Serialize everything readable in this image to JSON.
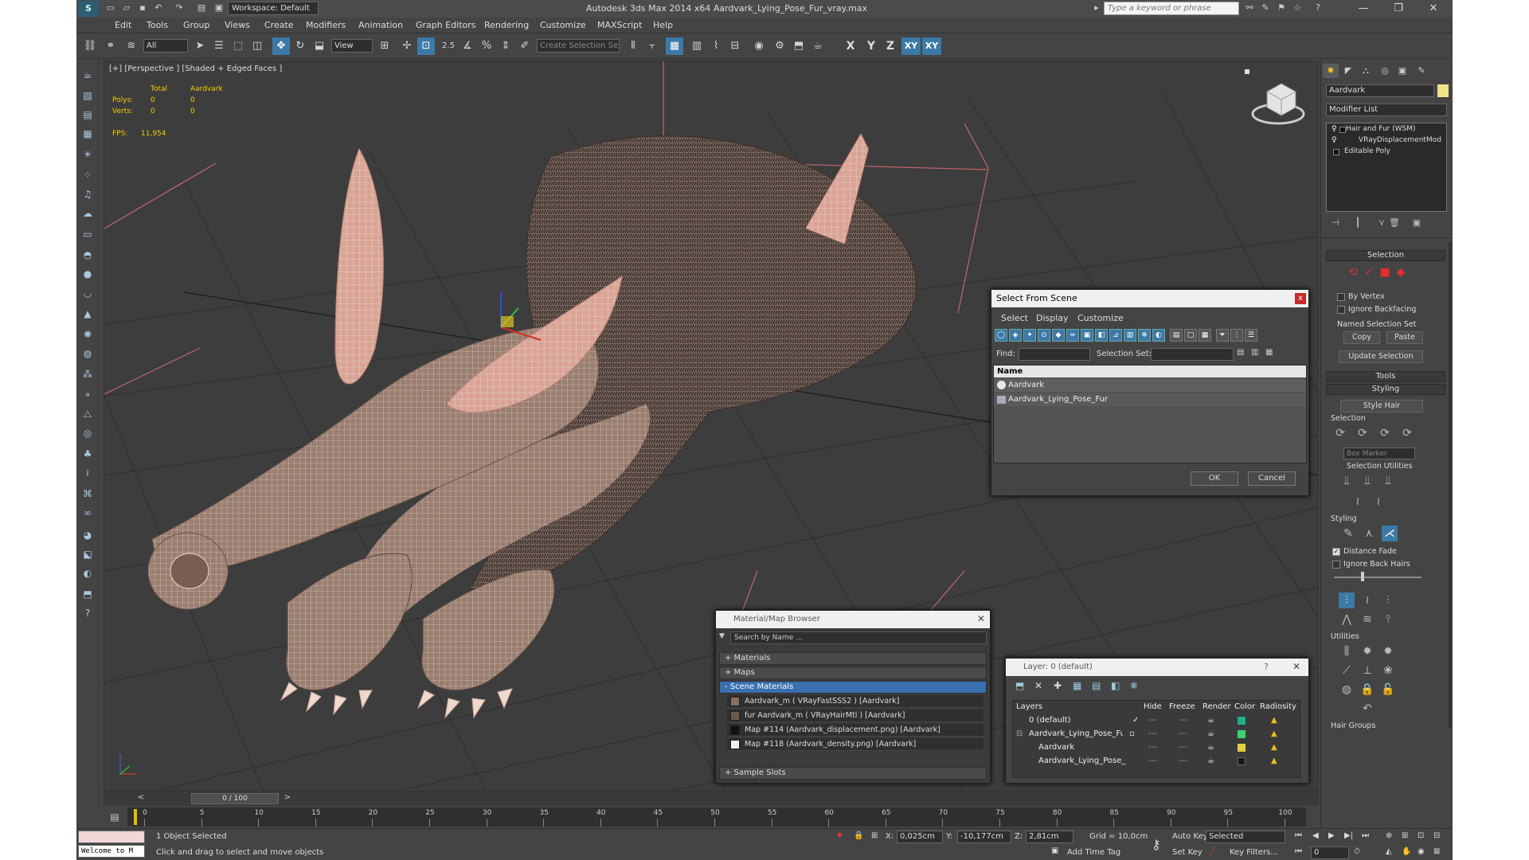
{
  "window": {
    "title": "Autodesk 3ds Max  2014 x64      Aardvark_Lying_Pose_Fur_vray.max",
    "workspace": "Workspace: Default",
    "search_placeholder": "Type a keyword or phrase",
    "minimize": "—",
    "maximize": "❐",
    "close": "✕"
  },
  "menu": [
    "Edit",
    "Tools",
    "Group",
    "Views",
    "Create",
    "Modifiers",
    "Animation",
    "Graph Editors",
    "Rendering",
    "Customize",
    "MAXScript",
    "Help"
  ],
  "toolbar": {
    "filter_dropdown": "All",
    "refcoord_dropdown": "View",
    "snap_label": "2.5",
    "named_sel_placeholder": "Create Selection Se",
    "axes": [
      "X",
      "Y",
      "Z",
      "XY",
      "XY"
    ]
  },
  "viewport": {
    "label": "[+] [Perspective ] [Shaded + Edged Faces ]",
    "stats": {
      "col_total": "Total",
      "col_obj": "Aardvark",
      "polys_label": "Polys:",
      "polys_total": "0",
      "polys_obj": "0",
      "verts_label": "Verts:",
      "verts_total": "0",
      "verts_obj": "0",
      "fps_label": "FPS:",
      "fps_value": "11,954"
    }
  },
  "select_from_scene": {
    "title": "Select From Scene",
    "close": "x",
    "menu": [
      "Select",
      "Display",
      "Customize"
    ],
    "find_label": "Find:",
    "selset_label": "Selection Set:",
    "col_name": "Name",
    "items": [
      "Aardvark",
      "Aardvark_Lying_Pose_Fur"
    ],
    "ok": "OK",
    "cancel": "Cancel"
  },
  "material_browser": {
    "title": "Material/Map Browser",
    "search": "Search by Name ...",
    "groups": {
      "materials": "+ Materials",
      "maps": "+ Maps",
      "scene": "- Scene Materials",
      "slots": "+ Sample Slots"
    },
    "items": [
      "Aardvark_m  ( VRayFastSSS2 )  [Aardvark]",
      "fur Aardvark_m  ( VRayHairMtl )  [Aardvark]",
      "Map #114 (Aardvark_displacement.png) [Aardvark]",
      "Map #118 (Aardvark_density.png) [Aardvark]"
    ],
    "close": "✕"
  },
  "layer": {
    "title": "Layer: 0 (default)",
    "help": "?",
    "close": "✕",
    "cols": [
      "Layers",
      "Hide",
      "Freeze",
      "Render",
      "Color",
      "Radiosity"
    ],
    "rows": [
      {
        "name": "0 (default)",
        "color": "#1fb08a"
      },
      {
        "name": "Aardvark_Lying_Pose_Fur",
        "color": "#3fd070"
      },
      {
        "name": "Aardvark",
        "color": "#e0d040"
      },
      {
        "name": "Aardvark_Lying_Pose_",
        "color": "#1a1a1a"
      }
    ]
  },
  "command_panel": {
    "object_name": "Aardvark",
    "modifier_list": "Modifier List",
    "stack": [
      "Hair and Fur (WSM)",
      "VRayDisplacementMod",
      "Editable Poly"
    ],
    "selection_rollout": "Selection",
    "by_vertex": "By Vertex",
    "ignore_backfacing": "Ignore Backfacing",
    "named_sel_set": "Named Selection Set",
    "copy": "Copy",
    "paste": "Paste",
    "update_selection": "Update Selection",
    "tools_rollout": "Tools",
    "styling_rollout": "Styling",
    "style_hair": "Style Hair",
    "selection_group": "Selection",
    "box_marker": "Box Marker",
    "selection_utilities": "Selection Utilities",
    "styling_group": "Styling",
    "distance_fade": "Distance Fade",
    "ignore_back_hairs": "Ignore Back Hairs",
    "utilities_group": "Utilities",
    "hair_groups": "Hair Groups"
  },
  "timeline": {
    "frame": "0 / 100",
    "ticks": [
      "0",
      "5",
      "10",
      "15",
      "20",
      "25",
      "30",
      "35",
      "40",
      "45",
      "50",
      "55",
      "60",
      "65",
      "70",
      "75",
      "80",
      "85",
      "90",
      "95",
      "100"
    ]
  },
  "status": {
    "maxscript": "Welcome to M",
    "selected": "1 Object Selected",
    "prompt": "Click and drag to select and move objects",
    "x_label": "X:",
    "x_value": "0,025cm",
    "y_label": "Y:",
    "y_value": "-10,177cm",
    "z_label": "Z:",
    "z_value": "2,81cm",
    "grid": "Grid = 10,0cm",
    "add_time_tag": "Add Time Tag",
    "auto_key": "Auto Key",
    "set_key": "Set Key",
    "selected_dropdown": "Selected",
    "key_filters": "Key Filters...",
    "frame_value": "0"
  }
}
